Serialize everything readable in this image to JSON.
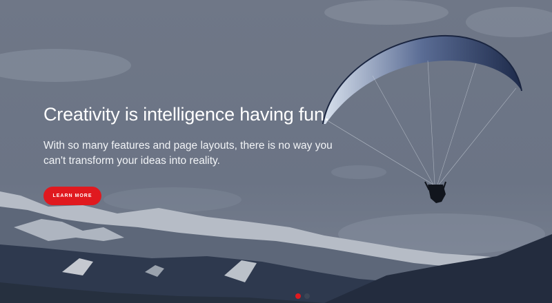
{
  "hero": {
    "headline": "Creativity is intelligence having fun.",
    "lead": "With so many features and page layouts, there is no way you can't transform your ideas into reality.",
    "cta_label": "LEARN MORE"
  },
  "slider": {
    "slide_count": 2,
    "active_index": 0
  },
  "colors": {
    "accent": "#e0191f",
    "dot_active": "#e0191f",
    "dot_inactive": "#3d4656",
    "text": "#ffffff"
  },
  "background": {
    "subject": "paraglider-over-snowy-mountains"
  }
}
